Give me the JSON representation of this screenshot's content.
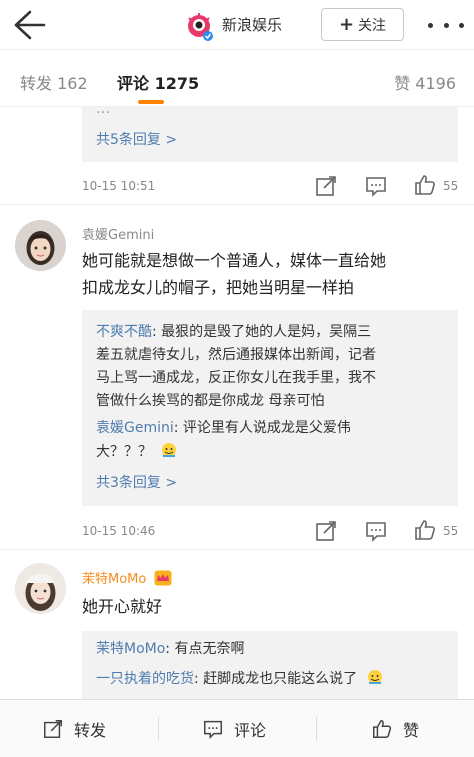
{
  "header": {
    "brand_name": "新浪娱乐",
    "follow_label": "关注",
    "back_icon": "arrow-left-icon",
    "more_icon": "ellipsis-icon"
  },
  "tabs": {
    "repost": "转发 162",
    "comment": "评论 1275",
    "like": "赞 4196"
  },
  "colors": {
    "accent": "#ff8200",
    "link": "#507daf",
    "vip_name": "#f78d1f"
  },
  "comment0": {
    "sub_partial": "…",
    "reply_label": "共5条回复 >",
    "time": "10-15 10:51",
    "likes": "55"
  },
  "comment1": {
    "name": "袁媛Gemini",
    "text_line1": "她可能就是想做一个普通人，媒体一直给她",
    "text_line2": "扣成龙女儿的帽子，把她当明星一样拍",
    "sub1_name": "不爽不酷",
    "sub1_line1": ": 最狠的是毁了她的人是妈，吴隔三",
    "sub1_line2": "差五就虐待女儿，然后通报媒体出新闻，记者",
    "sub1_line3": "马上骂一通成龙，反正你女儿在我手里，我不",
    "sub1_line4": "管做什么挨骂的都是你成龙  母亲可怕",
    "sub2_name": "袁媛Gemini",
    "sub2_line1": ": 评论里有人说成龙是父爱伟",
    "sub2_line2": "大？？？",
    "reply_label": "共3条回复 >",
    "time": "10-15 10:46",
    "likes": "55"
  },
  "comment2": {
    "name": "茉特MoMo",
    "text": "她开心就好",
    "sub1_name": "茉特MoMo",
    "sub1_text": ": 有点无奈啊",
    "sub2_name": "一只执着的吃货",
    "sub2_text": ": 赶脚成龙也只能这么说了"
  },
  "bottom": {
    "repost": "转发",
    "comment": "评论",
    "like": "赞"
  }
}
